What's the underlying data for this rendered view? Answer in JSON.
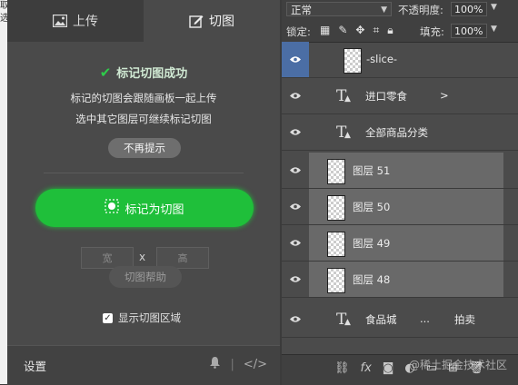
{
  "edge": {
    "chars": [
      "取",
      "选"
    ]
  },
  "plugin": {
    "tabs": [
      {
        "label": "上传",
        "icon": "image-icon"
      },
      {
        "label": "切图",
        "icon": "edit-icon"
      }
    ],
    "status": "标记切图成功",
    "desc_line1": "标记的切图会跟随画板一起上传",
    "desc_line2": "选中其它图层可继续标记切图",
    "dont_remind": "不再提示",
    "mark_button": "标记为切图",
    "width_placeholder": "宽",
    "height_placeholder": "高",
    "times": "x",
    "help": "切图帮助",
    "show_area": "显示切图区域",
    "show_area_checked": true,
    "settings": "设置",
    "footer_divider": "|",
    "code_icon": "</>"
  },
  "layers_panel": {
    "blend_mode": "正常",
    "opacity_label": "不透明度:",
    "opacity": "100%",
    "lock_label": "锁定:",
    "fill_label": "填充:",
    "fill": "100%",
    "layers": [
      {
        "name": "-slice-",
        "kind": "slice",
        "selected": true
      },
      {
        "name": "进口零食",
        "suffix": ">",
        "kind": "text"
      },
      {
        "name": "全部商品分类",
        "kind": "text"
      },
      {
        "name": "图层 51",
        "kind": "pixel",
        "highlight": true
      },
      {
        "name": "图层 50",
        "kind": "pixel",
        "highlight": true
      },
      {
        "name": "图层 49",
        "kind": "pixel",
        "highlight": true
      },
      {
        "name": "图层 48",
        "kind": "pixel",
        "highlight": true
      },
      {
        "name": "食品城",
        "middle": "...",
        "right": "拍卖",
        "kind": "text"
      }
    ],
    "watermark": "@稀土掘金技术社区"
  },
  "colors": {
    "accent_green": "#1fbf3a",
    "eye_selected": "#4b6ea5"
  }
}
